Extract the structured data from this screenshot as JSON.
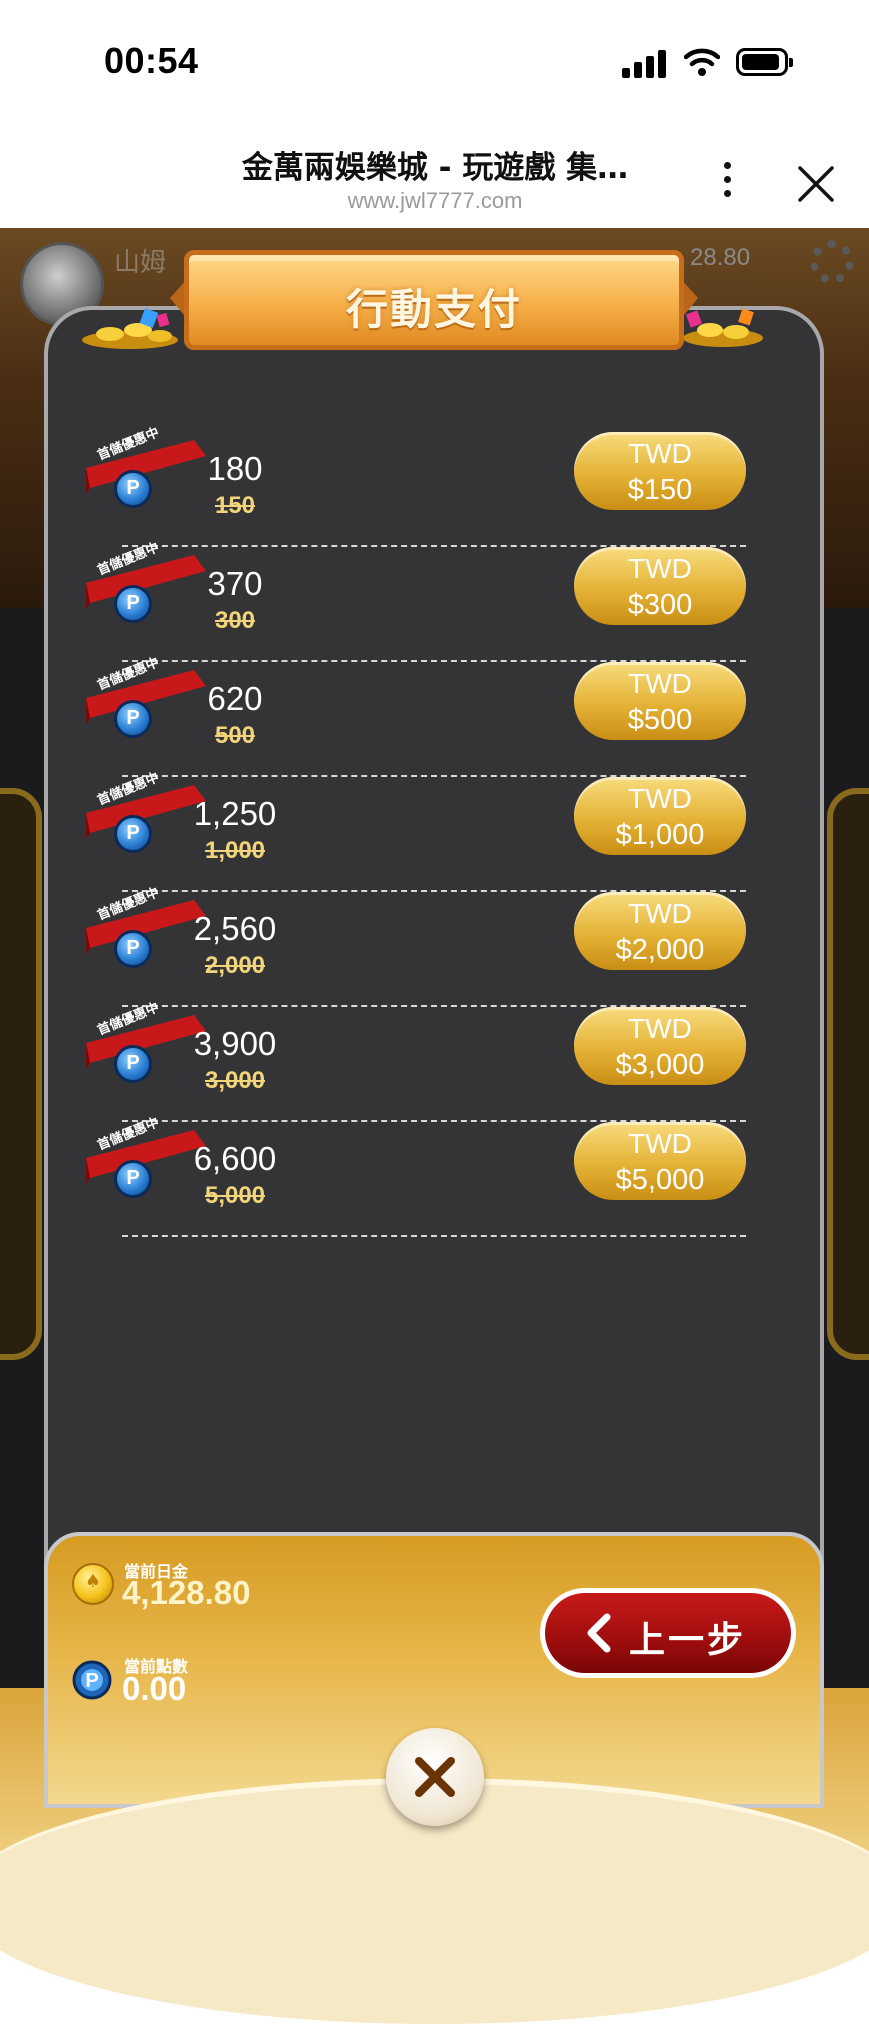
{
  "status_bar": {
    "time": "00:54"
  },
  "browser": {
    "title": "金萬兩娛樂城 - 玩遊戲 集…",
    "url": "www.jwl7777.com",
    "more_icon": "more-vertical-icon",
    "close_icon": "close-icon"
  },
  "background": {
    "user_name": "山姆",
    "balance_partial": "28.80"
  },
  "dialog": {
    "title": "行動支付",
    "ribbon_label": "首儲優惠中",
    "items": [
      {
        "points": "180",
        "original": "150",
        "currency": "TWD",
        "price": "$150"
      },
      {
        "points": "370",
        "original": "300",
        "currency": "TWD",
        "price": "$300"
      },
      {
        "points": "620",
        "original": "500",
        "currency": "TWD",
        "price": "$500"
      },
      {
        "points": "1,250",
        "original": "1,000",
        "currency": "TWD",
        "price": "$1,000"
      },
      {
        "points": "2,560",
        "original": "2,000",
        "currency": "TWD",
        "price": "$2,000"
      },
      {
        "points": "3,900",
        "original": "3,000",
        "currency": "TWD",
        "price": "$3,000"
      },
      {
        "points": "6,600",
        "original": "5,000",
        "currency": "TWD",
        "price": "$5,000"
      }
    ]
  },
  "footer": {
    "gold_label": "當前日金",
    "gold_value": "4,128.80",
    "points_label": "當前點數",
    "points_value": "0.00",
    "back_label": "上一步"
  },
  "colors": {
    "accent_gold": "#e4b236",
    "back_red": "#b01212",
    "panel": "#343437"
  }
}
